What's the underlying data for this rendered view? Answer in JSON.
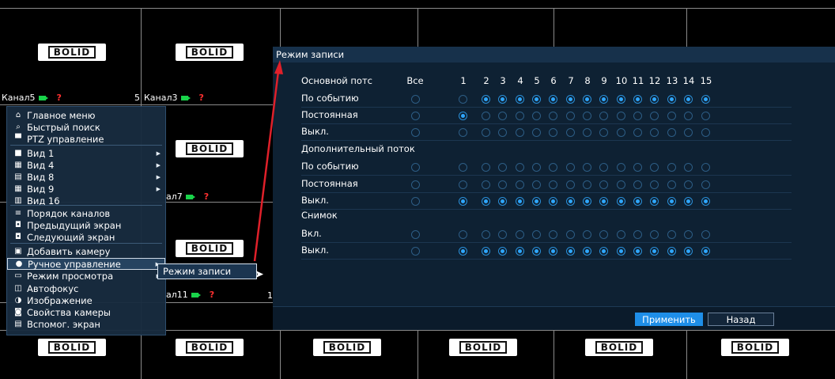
{
  "channels": {
    "ch5": "Канал5",
    "ch3": "Канал3",
    "ch7": "ал7",
    "ch11": "ал11",
    "num5": "5",
    "num1": "1",
    "alert": "?"
  },
  "logo_text": "BOLID",
  "menu": {
    "items": [
      {
        "icon": "⌂",
        "label": "Главное меню"
      },
      {
        "icon": "⌕",
        "label": "Быстрый поиск"
      },
      {
        "icon": "▀",
        "label": "PTZ управление"
      },
      {
        "icon": "■",
        "label": "Вид 1"
      },
      {
        "icon": "▦",
        "label": "Вид 4"
      },
      {
        "icon": "▤",
        "label": "Вид 8"
      },
      {
        "icon": "▦",
        "label": "Вид 9"
      },
      {
        "icon": "▥",
        "label": "Вид 16"
      },
      {
        "icon": "≡",
        "label": "Порядок каналов"
      },
      {
        "icon": "◘",
        "label": "Предыдущий экран"
      },
      {
        "icon": "◘",
        "label": "Следующий экран"
      },
      {
        "icon": "▣",
        "label": "Добавить камеру"
      },
      {
        "icon": "●",
        "label": "Ручное управление"
      },
      {
        "icon": "▭",
        "label": "Режим просмотра"
      },
      {
        "icon": "◫",
        "label": "Автофокус"
      },
      {
        "icon": "◑",
        "label": "Изображение"
      },
      {
        "icon": "◙",
        "label": "Свойства камеры"
      },
      {
        "icon": "▤",
        "label": "Вспомог. экран"
      }
    ],
    "submenu": "Режим записи"
  },
  "dialog": {
    "title": "Режим записи",
    "header_label": "Основной потс",
    "col_all": "Все",
    "columns": [
      "1",
      "2",
      "3",
      "4",
      "5",
      "6",
      "7",
      "8",
      "9",
      "10",
      "11",
      "12",
      "13",
      "14",
      "15"
    ],
    "section2": "Дополнительный поток",
    "section3": "Снимок",
    "rows": [
      {
        "label": "По событию",
        "all": false,
        "on": [
          false,
          true,
          true,
          true,
          true,
          true,
          true,
          true,
          true,
          true,
          true,
          true,
          true,
          true,
          true
        ]
      },
      {
        "label": "Постоянная",
        "all": false,
        "on": [
          true,
          false,
          false,
          false,
          false,
          false,
          false,
          false,
          false,
          false,
          false,
          false,
          false,
          false,
          false
        ]
      },
      {
        "label": "Выкл.",
        "all": false,
        "on": [
          false,
          false,
          false,
          false,
          false,
          false,
          false,
          false,
          false,
          false,
          false,
          false,
          false,
          false,
          false
        ]
      },
      {
        "label": "По событию",
        "all": false,
        "on": [
          false,
          false,
          false,
          false,
          false,
          false,
          false,
          false,
          false,
          false,
          false,
          false,
          false,
          false,
          false
        ]
      },
      {
        "label": "Постоянная",
        "all": false,
        "on": [
          false,
          false,
          false,
          false,
          false,
          false,
          false,
          false,
          false,
          false,
          false,
          false,
          false,
          false,
          false
        ]
      },
      {
        "label": "Выкл.",
        "all": false,
        "on": [
          true,
          true,
          true,
          true,
          true,
          true,
          true,
          true,
          true,
          true,
          true,
          true,
          true,
          true,
          true
        ]
      },
      {
        "label": "Вкл.",
        "all": false,
        "on": [
          false,
          false,
          false,
          false,
          false,
          false,
          false,
          false,
          false,
          false,
          false,
          false,
          false,
          false,
          false
        ]
      },
      {
        "label": "Выкл.",
        "all": false,
        "on": [
          true,
          true,
          true,
          true,
          true,
          true,
          true,
          true,
          true,
          true,
          true,
          true,
          true,
          true,
          true
        ]
      }
    ],
    "apply": "Применить",
    "back": "Назад"
  },
  "colors": {
    "accent": "#1e8ee8",
    "annotation_arrow": "#e0202a",
    "camera_icon": "#19d34a"
  }
}
